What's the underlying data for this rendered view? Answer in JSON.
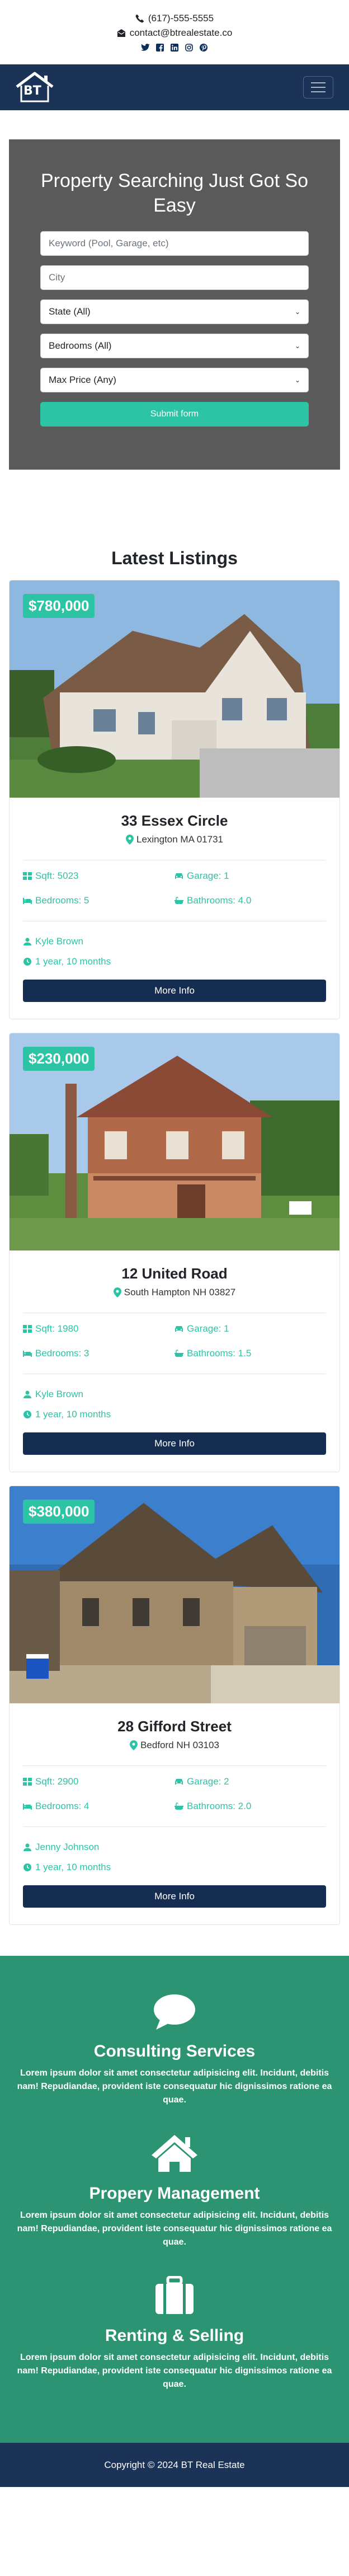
{
  "topbar": {
    "phone": "(617)-555-5555",
    "email": "contact@btrealestate.co",
    "social": [
      "twitter-icon",
      "facebook-icon",
      "linkedin-icon",
      "instagram-icon",
      "pinterest-icon"
    ]
  },
  "navbar": {
    "logo_text": "BT",
    "toggle_icon": "hamburger-icon"
  },
  "search": {
    "title": "Property Searching Just Got So Easy",
    "keyword_placeholder": "Keyword (Pool, Garage, etc)",
    "city_placeholder": "City",
    "state_value": "State (All)",
    "bedrooms_value": "Bedrooms (All)",
    "max_price_value": "Max Price (Any)",
    "submit_label": "Submit form"
  },
  "listings": {
    "title": "Latest Listings",
    "more_label": "More Info",
    "items": [
      {
        "price": "$780,000",
        "address": "33 Essex Circle",
        "location": "Lexington MA 01731",
        "sqft": "Sqft: 5023",
        "garage": "Garage: 1",
        "bedrooms": "Bedrooms: 5",
        "bathrooms": "Bathrooms: 4.0",
        "agent": "Kyle Brown",
        "age": "1 year, 10 months"
      },
      {
        "price": "$230,000",
        "address": "12 United Road",
        "location": "South Hampton NH 03827",
        "sqft": "Sqft: 1980",
        "garage": "Garage: 1",
        "bedrooms": "Bedrooms: 3",
        "bathrooms": "Bathrooms: 1.5",
        "agent": "Kyle Brown",
        "age": "1 year, 10 months"
      },
      {
        "price": "$380,000",
        "address": "28 Gifford Street",
        "location": "Bedford NH 03103",
        "sqft": "Sqft: 2900",
        "garage": "Garage: 2",
        "bedrooms": "Bedrooms: 4",
        "bathrooms": "Bathrooms: 2.0",
        "agent": "Jenny Johnson",
        "age": "1 year, 10 months"
      }
    ]
  },
  "services": [
    {
      "icon": "comment-icon",
      "title": "Consulting Services",
      "text": "Lorem ipsum dolor sit amet consectetur adipisicing elit. Incidunt, debitis nam! Repudiandae, provident iste consequatur hic dignissimos ratione ea quae."
    },
    {
      "icon": "home-icon",
      "title": "Propery Management",
      "text": "Lorem ipsum dolor sit amet consectetur adipisicing elit. Incidunt, debitis nam! Repudiandae, provident iste consequatur hic dignissimos ratione ea quae."
    },
    {
      "icon": "suitcase-icon",
      "title": "Renting & Selling",
      "text": "Lorem ipsum dolor sit amet consectetur adipisicing elit. Incidunt, debitis nam! Repudiandae, provident iste consequatur hic dignissimos ratione ea quae."
    }
  ],
  "footer": {
    "copyright": "Copyright © 2024 BT Real Estate"
  },
  "colors": {
    "navy": "#1a3357",
    "accent": "#2cc4a4",
    "services_bg": "#2c9472",
    "search_bg": "#5a5a5a"
  }
}
